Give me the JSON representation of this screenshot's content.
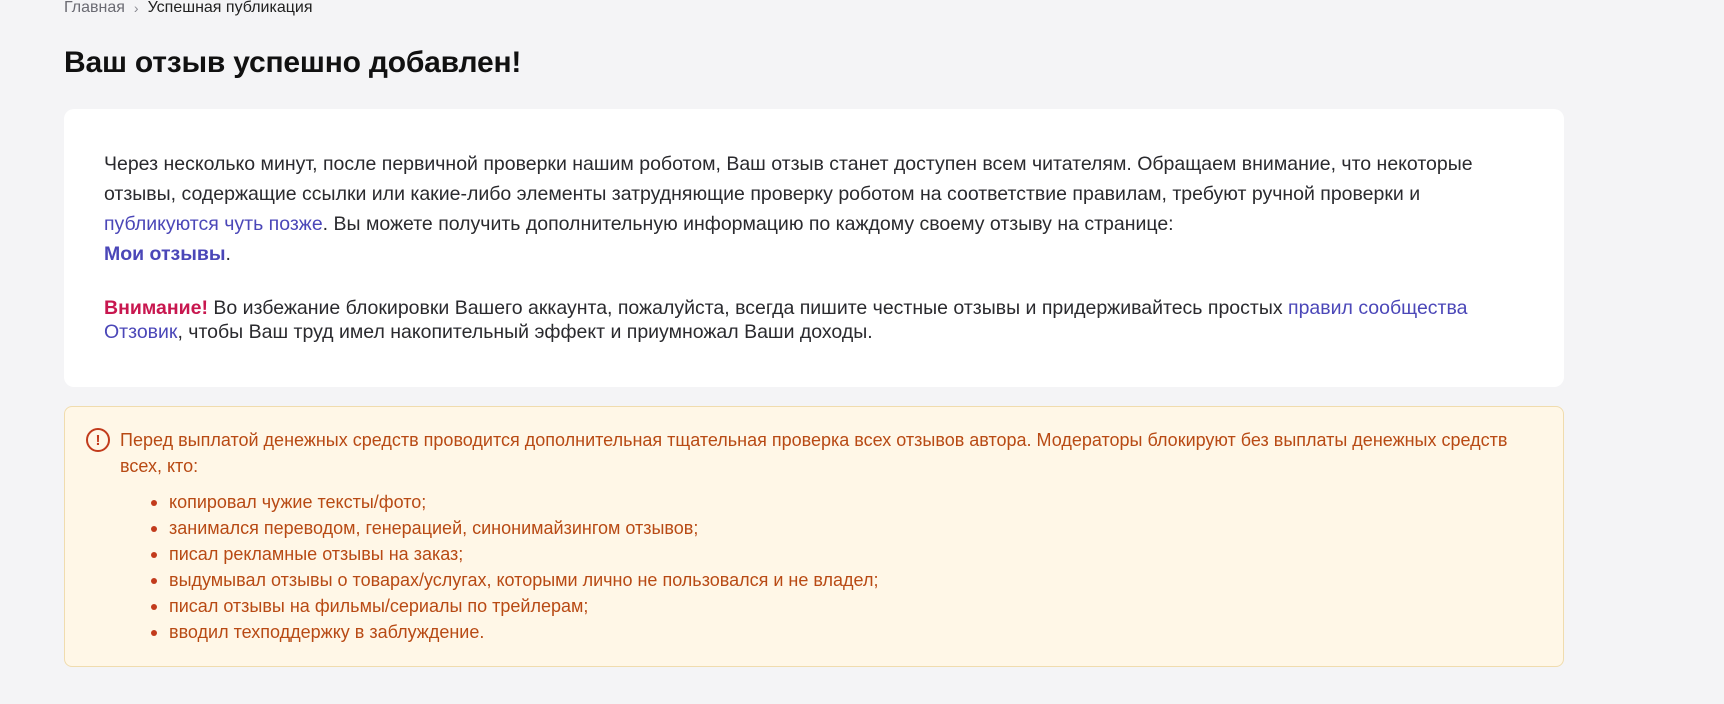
{
  "breadcrumb": {
    "home": "Главная",
    "separator": "›",
    "current": "Успешная публикация"
  },
  "page": {
    "title": "Ваш отзыв успешно добавлен!"
  },
  "card": {
    "para1_a": "Через несколько минут, после первичной проверки нашим роботом, Ваш отзыв станет доступен всем читателям. Обращаем внимание, что некоторые отзывы, содержащие ссылки или какие-либо элементы затрудняющие проверку роботом на соответствие правилам, требуют ручной проверки и ",
    "link_later": "публикуются чуть позже",
    "para1_b": ". Вы можете получить дополнительную информацию по каждому своему отзыву на странице: ",
    "link_my_reviews": "Мои отзывы",
    "para1_end": ".",
    "warning_label": "Внимание!",
    "para2_a": " Во избежание блокировки Вашего аккаунта, пожалуйста, всегда пишите честные отзывы и придерживайтесь простых ",
    "link_rules": "правил сообщества Отзовик",
    "para2_b": ", чтобы Ваш труд имел накопительный эффект и приумножал Ваши доходы."
  },
  "notice": {
    "icon": "!",
    "text": "Перед выплатой денежных средств проводится дополнительная тщательная проверка всех отзывов автора. Модераторы блокируют без выплаты денежных средств всех, кто:",
    "items": [
      "копировал чужие тексты/фото;",
      "занимался переводом, генерацией, синонимайзингом отзывов;",
      "писал рекламные отзывы на заказ;",
      "выдумывал отзывы о товарах/услугах, которыми лично не пользовался и не владел;",
      "писал отзывы на фильмы/сериалы по трейлерам;",
      "вводил техподдержку в заблуждение."
    ]
  },
  "colors": {
    "background": "#f4f4f6",
    "link": "#4b47b8",
    "warning": "#c8174f",
    "notice_bg": "#fff7e7",
    "notice_text": "#b84a14"
  }
}
